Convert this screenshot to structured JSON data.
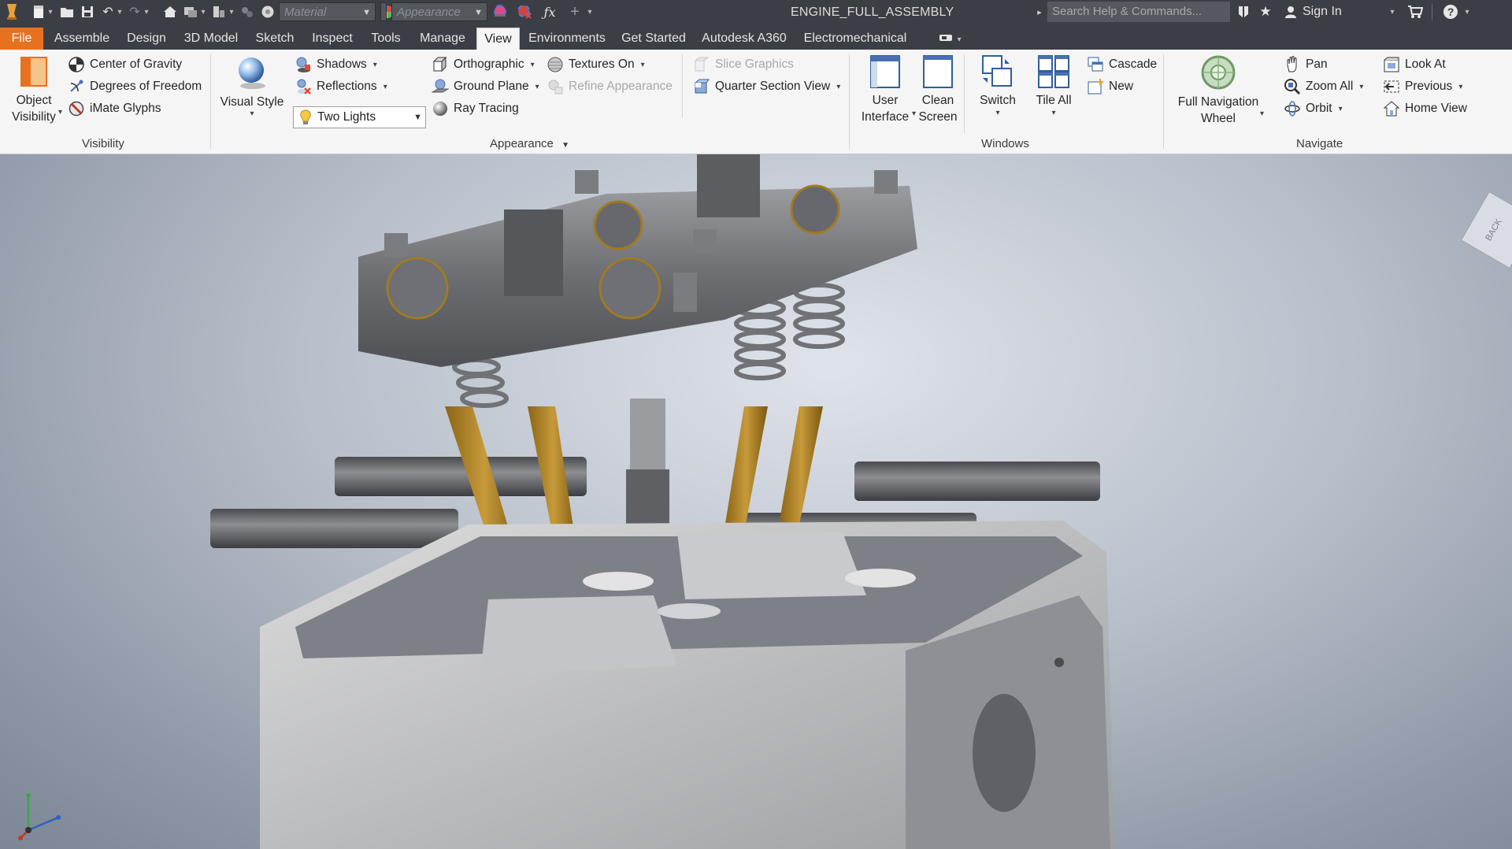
{
  "window": {
    "title": "ENGINE_FULL_ASSEMBLY",
    "search_placeholder": "Search Help & Commands...",
    "sign_in": "Sign In"
  },
  "quick_access": {
    "material": "Material",
    "appearance": "Appearance"
  },
  "tabs": [
    {
      "label": "File"
    },
    {
      "label": "Assemble"
    },
    {
      "label": "Design"
    },
    {
      "label": "3D Model"
    },
    {
      "label": "Sketch"
    },
    {
      "label": "Inspect"
    },
    {
      "label": "Tools"
    },
    {
      "label": "Manage"
    },
    {
      "label": "View"
    },
    {
      "label": "Environments"
    },
    {
      "label": "Get Started"
    },
    {
      "label": "Autodesk A360"
    },
    {
      "label": "Electromechanical"
    }
  ],
  "active_tab": "View",
  "ribbon": {
    "visibility": {
      "title": "Visibility",
      "object_visibility_1": "Object",
      "object_visibility_2": "Visibility",
      "center_of_gravity": "Center of Gravity",
      "degrees_of_freedom": "Degrees of Freedom",
      "imate_glyphs": "iMate Glyphs"
    },
    "appearance": {
      "title": "Appearance",
      "visual_style": "Visual Style",
      "shadows": "Shadows",
      "reflections": "Reflections",
      "two_lights": "Two Lights",
      "orthographic": "Orthographic",
      "ground_plane": "Ground Plane",
      "ray_tracing": "Ray Tracing",
      "textures_on": "Textures On",
      "refine_appearance": "Refine Appearance",
      "slice_graphics": "Slice Graphics",
      "quarter_section_view": "Quarter Section View"
    },
    "windows": {
      "title": "Windows",
      "user_interface_1": "User",
      "user_interface_2": "Interface",
      "clean_screen_1": "Clean",
      "clean_screen_2": "Screen",
      "switch": "Switch",
      "tile_all": "Tile All",
      "cascade": "Cascade",
      "new": "New"
    },
    "navigate": {
      "title": "Navigate",
      "full_nav_wheel_1": "Full Navigation",
      "full_nav_wheel_2": "Wheel",
      "pan": "Pan",
      "zoom_all": "Zoom All",
      "orbit": "Orbit",
      "look_at": "Look At",
      "previous": "Previous",
      "home_view": "Home View"
    }
  },
  "viewcube_label": "BACK",
  "colors": {
    "accent_file": "#e8711f",
    "titlebar": "#3b3f45",
    "ribbon": "#f5f5f5"
  }
}
